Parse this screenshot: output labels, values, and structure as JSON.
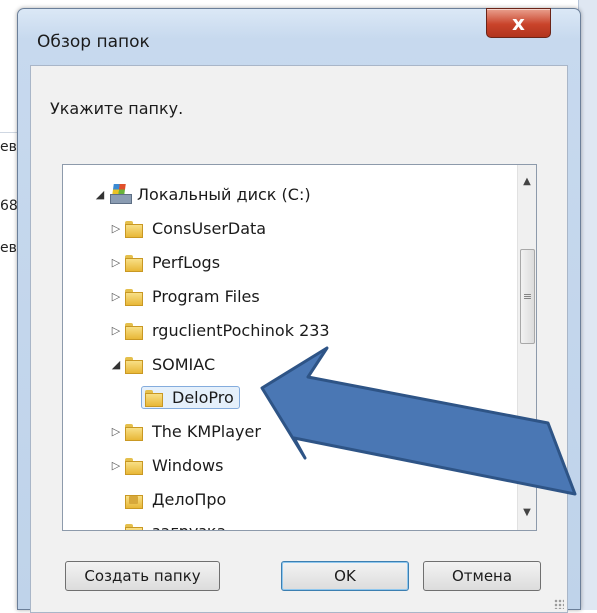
{
  "dialog": {
    "title": "Обзор папок",
    "close_glyph": "x",
    "prompt": "Укажите папку.",
    "buttons": {
      "new_folder": "Создать папку",
      "ok": "OK",
      "cancel": "Отмена"
    }
  },
  "tree": {
    "items": [
      {
        "label": "Локальный диск (C:)",
        "icon": "drive-icon",
        "expander": "expanded"
      },
      {
        "label": "ConsUserData",
        "icon": "folder-icon",
        "expander": "collapsed"
      },
      {
        "label": "PerfLogs",
        "icon": "folder-icon",
        "expander": "collapsed"
      },
      {
        "label": "Program Files",
        "icon": "folder-icon",
        "expander": "collapsed"
      },
      {
        "label": "rguclientPochinok 233",
        "icon": "folder-icon",
        "expander": "collapsed"
      },
      {
        "label": "SOMIAC",
        "icon": "folder-icon",
        "expander": "expanded"
      },
      {
        "label": "DeloPro",
        "icon": "folder-icon",
        "expander": "none",
        "selected": true
      },
      {
        "label": "The KMPlayer",
        "icon": "folder-icon",
        "expander": "collapsed"
      },
      {
        "label": "Windows",
        "icon": "folder-icon",
        "expander": "collapsed"
      },
      {
        "label": "ДелоПро",
        "icon": "locked-folder-icon",
        "expander": "none"
      },
      {
        "label": "загрузка",
        "icon": "folder-icon",
        "expander": "none"
      }
    ]
  },
  "background": {
    "fragments": [
      "ев",
      "68",
      "ев'"
    ]
  },
  "colors": {
    "arrow_fill": "#4a77b4",
    "arrow_stroke": "#2e5486",
    "selection": "#e5f0fb",
    "close_red": "#c9432a"
  }
}
